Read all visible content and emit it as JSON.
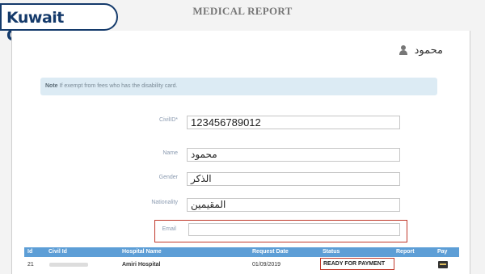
{
  "brand": {
    "name": "Kuwait Guide"
  },
  "page": {
    "title": "MEDICAL REPORT"
  },
  "user": {
    "name": "محمود"
  },
  "note": {
    "prefix": "Note",
    "text": "If exempt from fees who has the disability card."
  },
  "form": {
    "civil_id_label": "CivilID*",
    "civil_id_value": "123456789012",
    "name_label": "Name",
    "name_value": "محمود",
    "gender_label": "Gender",
    "gender_value": "الذكر",
    "nationality_label": "Nationality",
    "nationality_value": "المقيمين",
    "email_label": "Email",
    "email_value": ""
  },
  "table": {
    "headers": [
      "Id",
      "Civil Id",
      "Hospital Name",
      "Request Date",
      "Status",
      "Report",
      "Pay"
    ],
    "rows": [
      {
        "id": "21",
        "civil_id": "",
        "hospital": "Amiri Hospital",
        "date": "01/09/2019",
        "status": "READY FOR PAYMENT",
        "report": ""
      }
    ]
  },
  "icons": {
    "user": "user-icon",
    "pay": "credit-card-icon"
  },
  "colors": {
    "brand": "#143a6b",
    "header": "#5d9ed6",
    "highlight": "#c0392b",
    "note_bg": "#dcebf4"
  }
}
